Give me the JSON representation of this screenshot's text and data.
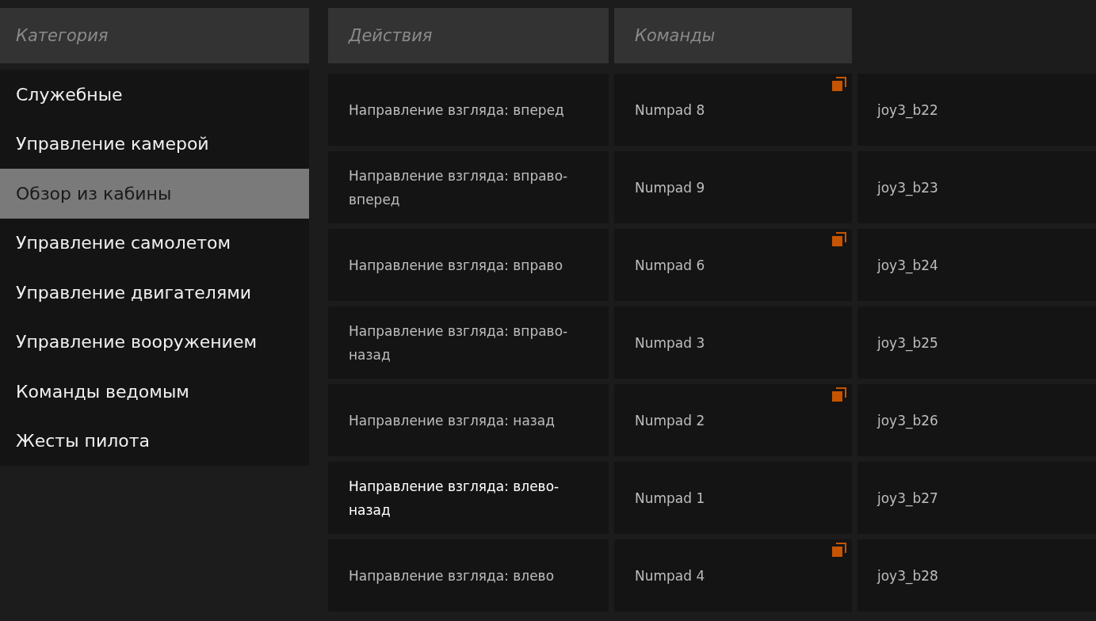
{
  "category_panel": {
    "header": "Категория",
    "items": [
      {
        "label": "Служебные",
        "selected": false
      },
      {
        "label": "Управление камерой",
        "selected": false
      },
      {
        "label": "Обзор из кабины",
        "selected": true
      },
      {
        "label": "Управление самолетом",
        "selected": false
      },
      {
        "label": "Управление двигателями",
        "selected": false
      },
      {
        "label": "Управление вооружением",
        "selected": false
      },
      {
        "label": "Команды ведомым",
        "selected": false
      },
      {
        "label": "Жесты пилота",
        "selected": false
      }
    ]
  },
  "bindings_table": {
    "columns": [
      "Действия",
      "Команды"
    ],
    "rows": [
      {
        "action": "Направление взгляда: вперед",
        "command": "Numpad 8",
        "command_2": "joy3_b22",
        "multiple": true,
        "highlighted": false
      },
      {
        "action": "Направление взгляда: вправо-вперед",
        "command": "Numpad 9",
        "command_2": "joy3_b23",
        "multiple": false,
        "highlighted": false
      },
      {
        "action": "Направление взгляда: вправо",
        "command": "Numpad 6",
        "command_2": "joy3_b24",
        "multiple": true,
        "highlighted": false
      },
      {
        "action": "Направление взгляда: вправо-назад",
        "command": "Numpad 3",
        "command_2": "joy3_b25",
        "multiple": false,
        "highlighted": false
      },
      {
        "action": "Направление взгляда: назад",
        "command": "Numpad 2",
        "command_2": "joy3_b26",
        "multiple": true,
        "highlighted": false
      },
      {
        "action": "Направление взгляда: влево-назад",
        "command": "Numpad 1",
        "command_2": "joy3_b27",
        "multiple": false,
        "highlighted": true
      },
      {
        "action": "Направление взгляда: влево",
        "command": "Numpad 4",
        "command_2": "joy3_b28",
        "multiple": true,
        "highlighted": false
      }
    ]
  }
}
